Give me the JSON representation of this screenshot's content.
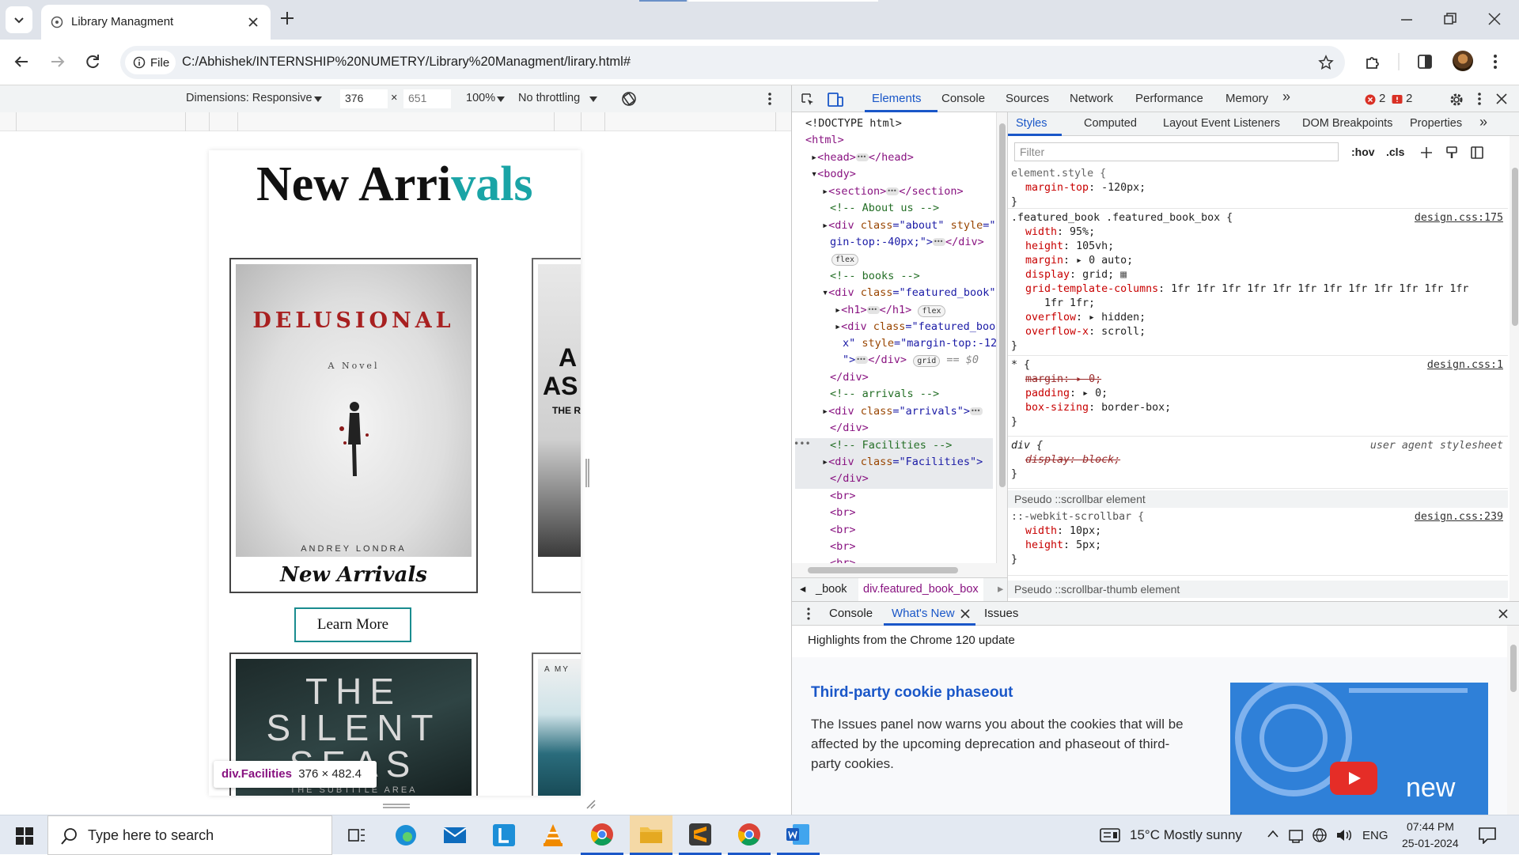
{
  "browser": {
    "tab_title": "Library Managment",
    "url": "C:/Abhishek/INTERNSHIP%20NUMETRY/Library%20Managment/lirary.html#",
    "file_chip": "File"
  },
  "device_toolbar": {
    "dimensions": "Dimensions: Responsive",
    "width": "376",
    "times": "×",
    "height": "651",
    "zoom": "100%",
    "throttle": "No throttling"
  },
  "page": {
    "heading_black": "New Arri",
    "heading_teal": "vals",
    "book1": {
      "title": "DELUSIONAL",
      "subtitle": "A Novel",
      "author": "ANDREY LONDRA",
      "caption": "New Arrivals"
    },
    "book2": {
      "line1": "A",
      "line2": "AS",
      "line3": "THE R"
    },
    "book3": {
      "line1": "THE",
      "line2": "SILENT",
      "line3": "SEAS",
      "line4": "THE SUBTITLE AREA"
    },
    "book4": {
      "line1": "A MY"
    },
    "learn_more": "Learn More",
    "tooltip_tag": "div.Facilities",
    "tooltip_size": "376 × 482.4"
  },
  "devtools": {
    "tabs": [
      "Elements",
      "Console",
      "Sources",
      "Network",
      "Performance",
      "Memory"
    ],
    "more": "»",
    "errors": "2",
    "issues": "2",
    "dom": {
      "doctype": "<!DOCTYPE html>",
      "html": "<html>",
      "head_open": "<head>",
      "head_close": "</head>",
      "body": "<body>",
      "section_open": "<section>",
      "section_close": "</section>",
      "c_about": "<!--  About us -->",
      "about_a": "<div ",
      "about_b": "class",
      "about_c": "=\"about\" ",
      "about_d": "style",
      "about_e": "=\"",
      "about_f": "gin-top:-40px;\">",
      "about_g": "</div>",
      "pill_flex": "flex",
      "c_books": "<!-- books -->",
      "fb_a": "<div ",
      "fb_b": "class",
      "fb_c": "=\"featured_book\"",
      "h1_open": "<h1>",
      "h1_close": "</h1>",
      "fbb_a": "<div ",
      "fbb_b": "class",
      "fbb_c": "=\"featured_boo",
      "fbb_d": "x\" ",
      "fbb_e": "style",
      "fbb_f": "=\"margin-top:-12",
      "fbb_g": "\">",
      "fbb_h": "</div>",
      "pill_grid": "grid",
      "eq": "== $0",
      "div_close": "</div>",
      "c_arrivals": "<!--    arrivals  -->",
      "arr_a": "<div ",
      "arr_b": "class",
      "arr_c": "=\"arrivals\">",
      "c_fac": "<!-- Facilities -->",
      "fac_a": "<div ",
      "fac_b": "class",
      "fac_c": "=\"Facilities\">",
      "br": "<br>"
    },
    "breadcrumbs": [
      "_book",
      "div.featured_book_box"
    ],
    "styles_tabs": [
      "Styles",
      "Computed",
      "Layout",
      "Event Listeners",
      "DOM Breakpoints",
      "Properties"
    ],
    "filter_placeholder": "Filter",
    "hov": ":hov",
    "cls": ".cls",
    "rules": {
      "r1_sel": "element.style {",
      "r1_p1": "margin-top",
      "r1_v1": "-120px;",
      "r2_sel": ".featured_book .featured_book_box {",
      "r2_src": "design.css:175",
      "r2_p1": "width",
      "r2_v1": "95%;",
      "r2_p2": "height",
      "r2_v2": "105vh;",
      "r2_p3": "margin",
      "r2_v3": "0 auto;",
      "r2_p4": "display",
      "r2_v4": "grid;",
      "r2_p5": "grid-template-columns",
      "r2_v5": "1fr 1fr 1fr 1fr 1fr 1fr 1fr 1fr 1fr 1fr 1fr 1fr",
      "r2_v5b": "1fr 1fr;",
      "r2_p6": "overflow",
      "r2_v6": "hidden;",
      "r2_p7": "overflow-x",
      "r2_v7": "scroll;",
      "r3_sel": "* {",
      "r3_src": "design.css:1",
      "r3_p1": "margin",
      "r3_v1": "0;",
      "r3_p2": "padding",
      "r3_v2": "0;",
      "r3_p3": "box-sizing",
      "r3_v3": "border-box;",
      "r4_sel": "div {",
      "r4_src": "user agent stylesheet",
      "r4_p1": "display",
      "r4_v1": "block;",
      "hdr1": "Pseudo ::scrollbar element",
      "r5_sel": "::-webkit-scrollbar {",
      "r5_src": "design.css:239",
      "r5_p1": "width",
      "r5_v1": "10px;",
      "r5_p2": "height",
      "r5_v2": "5px;",
      "hdr2": "Pseudo ::scrollbar-thumb element",
      "close": "}"
    },
    "drawer": {
      "tabs": [
        "Console",
        "What's New",
        "Issues"
      ],
      "highlights": "Highlights from the Chrome 120 update",
      "title": "Third-party cookie phaseout",
      "body": "The Issues panel now warns you about the cookies that will be affected by the upcoming deprecation and phaseout of third-party cookies.",
      "video_label": "new"
    }
  },
  "taskbar": {
    "search_placeholder": "Type here to search",
    "weather": "15°C  Mostly sunny",
    "lang": "ENG",
    "time": "07:44 PM",
    "date": "25-01-2024"
  },
  "colors": {
    "accent": "#1a57c8",
    "teal": "#1aa4a6",
    "error": "#d93025"
  }
}
